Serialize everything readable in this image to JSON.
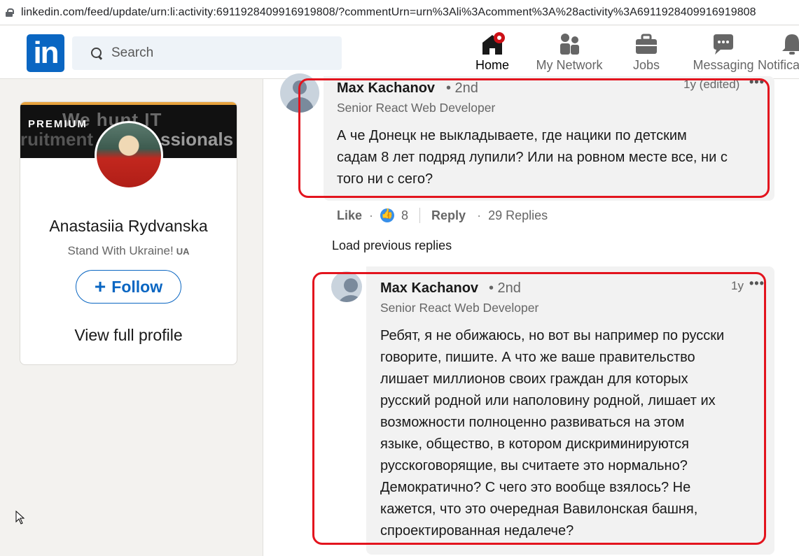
{
  "browser": {
    "url": "linkedin.com/feed/update/urn:li:activity:6911928409916919808/?commentUrn=urn%3Ali%3Acomment%3A%28activity%3A6911928409916919808"
  },
  "nav": {
    "logo": "in",
    "search_placeholder": "Search",
    "items": [
      {
        "label": "Home",
        "icon": "home-icon",
        "active": true
      },
      {
        "label": "My Network",
        "icon": "network-icon"
      },
      {
        "label": "Jobs",
        "icon": "briefcase-icon"
      },
      {
        "label": "Messaging",
        "icon": "message-icon"
      },
      {
        "label": "Notifications",
        "icon": "bell-icon"
      }
    ]
  },
  "profile_card": {
    "premium": "PREMIUM",
    "banner_text": [
      "We hunt IT",
      "ruitment",
      "ssionals"
    ],
    "name": "Anastasiia Rydvanska",
    "headline": "Stand With Ukraine!",
    "headline_flag": "UA",
    "follow_label": "Follow",
    "view_profile": "View full profile"
  },
  "comments": [
    {
      "author": "Max Kachanov",
      "degree": "• 2nd",
      "title": "Senior React Web Developer",
      "time": "1y (edited)",
      "lines": [
        "А че Донецк не выкладываете, где нацики по детским",
        "садам 8 лет подряд лупили? Или на ровном месте все, ни с",
        "того ни с сего?"
      ],
      "like_label": "Like",
      "like_count": "8",
      "reply_label": "Reply",
      "replies": "29 Replies"
    },
    {
      "author": "Max Kachanov",
      "degree": "• 2nd",
      "title": "Senior React Web Developer",
      "time": "1y",
      "lines": [
        "Ребят, я не обижаюсь, но вот вы например по русски",
        "говорите, пишите. А что же ваше правительство",
        "лишает миллионов своих граждан для которых",
        "русский родной или наполовину родной, лишает их",
        "возможности полноценно развиваться на этом",
        "языке, общество, в котором дискриминируются",
        "русскоговорящие, вы считаете это нормально?",
        "Демократично? С чего это вообще взялось? Не",
        "кажется, что это очередная Вавилонская башня,",
        "спроектированная недалече?"
      ]
    }
  ],
  "load_previous": "Load previous replies",
  "colors": {
    "brand": "#0a66c2",
    "highlight": "#e3141e"
  }
}
